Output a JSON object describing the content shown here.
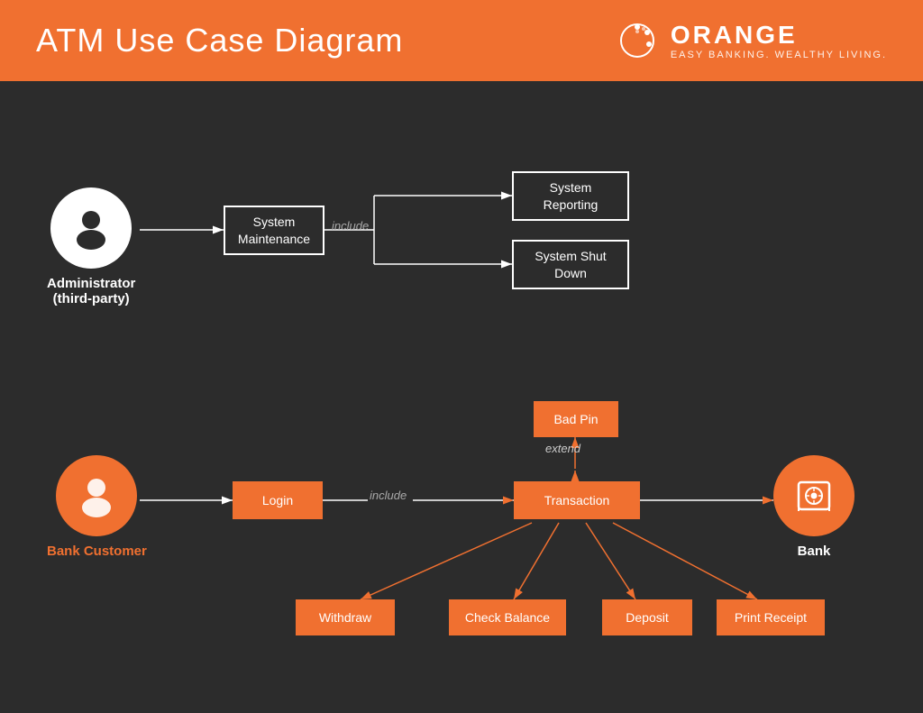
{
  "header": {
    "title": "ATM Use Case Diagram",
    "logo_name": "ORANGE",
    "logo_tagline": "EASY BANKING. WEALTHY LIVING."
  },
  "actors": {
    "admin": {
      "label_line1": "Administrator",
      "label_line2": "(third-party)"
    },
    "bank_customer": {
      "label": "Bank Customer"
    },
    "bank": {
      "label": "Bank"
    }
  },
  "boxes": {
    "system_maintenance": "System Maintenance",
    "system_reporting": "System Reporting",
    "system_shutdown": "System Shut Down",
    "bad_pin": "Bad Pin",
    "login": "Login",
    "transaction": "Transaction",
    "withdraw": "Withdraw",
    "check_balance": "Check Balance",
    "deposit": "Deposit",
    "print_receipt": "Print Receipt"
  },
  "labels": {
    "include1": "include",
    "include2": "include",
    "extend": "extend"
  }
}
